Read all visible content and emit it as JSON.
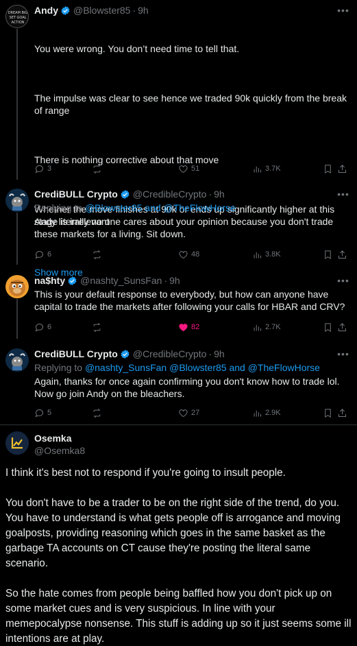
{
  "tweets": [
    {
      "name": "Andy",
      "handle": "@Blowster85",
      "time": "9h",
      "avatar_text": "DREAM BIG\nSTAY GOAL\nTAKE ACTION",
      "paragraphs": [
        "You were wrong. You don’t need time to tell that.",
        "The impulse was clear to see hence we traded 90k quickly from the break of range",
        "There is nothing corrective about that move",
        "Whether the move finishes at 90k or ends up significantly higher at this stage is irrelevant\n..."
      ],
      "show_more": "Show more",
      "replies": "3",
      "reposts": "",
      "likes": "51",
      "views": "3.7K"
    },
    {
      "name": "CrediBULL Crypto",
      "handle": "@CredibleCrypto",
      "time": "9h",
      "replying_prefix": "Replying to",
      "replying_to": "@Blowster85 and @TheFlowHorse",
      "text": "Andy literally no one cares about your opinion because you don't trade these markets for a living. Sit down.",
      "replies": "6",
      "reposts": "",
      "likes": "48",
      "views": "3.8K"
    },
    {
      "name": "na$hty",
      "handle": "@nashty_SunsFan",
      "time": "9h",
      "text": "This is your default response to everybody, but how can anyone have capital to trade the markets after following your calls for HBAR and CRV?",
      "replies": "6",
      "reposts": "",
      "likes": "82",
      "views": "2.7K"
    },
    {
      "name": "CrediBULL Crypto",
      "handle": "@CredibleCrypto",
      "time": "9h",
      "replying_prefix": "Replying to",
      "replying_to": "@nashty_SunsFan @Blowster85 and @TheFlowHorse",
      "text": "Again, thanks for once again confirming you don't know how to trade lol. Now go join Andy on the bleachers.",
      "replies": "5",
      "reposts": "",
      "likes": "27",
      "views": "2.9K"
    }
  ],
  "main_post": {
    "name": "Osemka",
    "handle": "@Osemka8",
    "paragraphs": [
      "I think it's best not to respond if you're going to insult people.",
      "You don't have to be a trader to be on the right side of the trend, do you. You have to understand is what gets people off is arrogance and moving goalposts, providing reasoning which goes in the same basket as the garbage TA accounts on CT cause they're posting the literal same scenario.",
      "So the hate comes from people being baffled how you don't pick up on some market cues and is very suspicious. In line with your memepocalypse nonsense. This stuff is adding up so it just seems some ill intentions are at play."
    ]
  },
  "colors": {
    "background": "#000000",
    "text": "#e7e9ea",
    "muted": "#71767b",
    "link": "#1d9bf0",
    "like": "#f91880",
    "verified": "#1d9bf0"
  },
  "icons": [
    "reply-icon",
    "repost-icon",
    "like-icon",
    "views-icon",
    "bookmark-icon",
    "share-icon",
    "verified-icon",
    "more-icon"
  ]
}
